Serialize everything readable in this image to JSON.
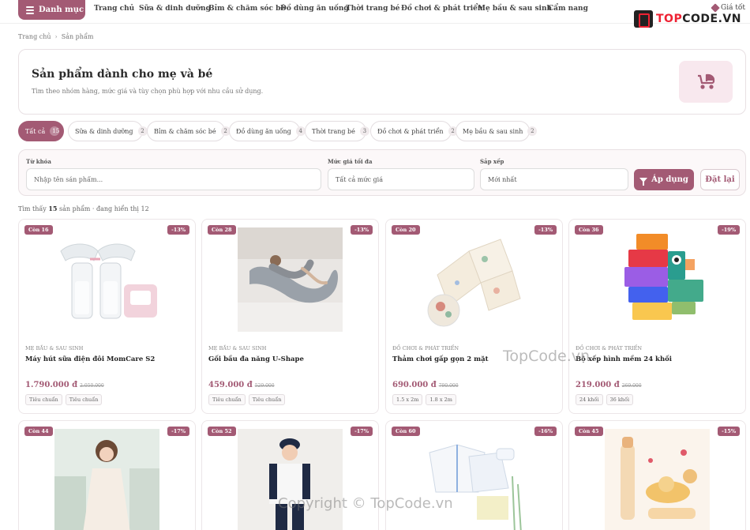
{
  "nav": {
    "menu_label": "Danh mục",
    "links": [
      "Trang chủ",
      "Sữa & dinh dưỡng",
      "Bỉm & chăm sóc bé",
      "Đồ dùng ăn uống",
      "Thời trang bé",
      "Đồ chơi & phát triển",
      "Mẹ bầu & sau sinh",
      "Cẩm nang"
    ],
    "cart_label": "Giá tốt",
    "logo_a": "TOP",
    "logo_b": "CODE.VN"
  },
  "breadcrumb": [
    "Trang chủ",
    "Sản phẩm"
  ],
  "hero": {
    "title": "Sản phẩm dành cho mẹ và bé",
    "subtitle": "Tìm theo nhóm hàng, mức giá và tùy chọn phù hợp với nhu cầu sử dụng."
  },
  "categories": [
    {
      "label": "Tất cả",
      "count": "15"
    },
    {
      "label": "Sữa & dinh dưỡng",
      "count": "2"
    },
    {
      "label": "Bỉm & chăm sóc bé",
      "count": "2"
    },
    {
      "label": "Đồ dùng ăn uống",
      "count": "4"
    },
    {
      "label": "Thời trang bé",
      "count": "3"
    },
    {
      "label": "Đồ chơi & phát triển",
      "count": "2"
    },
    {
      "label": "Mẹ bầu & sau sinh",
      "count": "2"
    }
  ],
  "filter": {
    "keyword_label": "Từ khóa",
    "keyword_placeholder": "Nhập tên sản phẩm...",
    "price_label": "Mức giá tối đa",
    "price_value": "Tất cả mức giá",
    "sort_label": "Sắp xếp",
    "sort_value": "Mới nhất",
    "apply_label": "Áp dụng",
    "reset_label": "Đặt lại"
  },
  "result": {
    "prefix": "Tìm thấy",
    "count": "15",
    "suffix": "sản phẩm · đang hiển thị 12"
  },
  "products": [
    {
      "stock": "Còn 16",
      "discount": "-13%",
      "category": "Mẹ bầu & sau sinh",
      "name": "Máy hút sữa điện đôi MomCare S2",
      "price": "1.790.000 đ",
      "old_price": "2.050.000",
      "tags": [
        "Tiêu chuẩn",
        "Tiêu chuẩn"
      ]
    },
    {
      "stock": "Còn 28",
      "discount": "-13%",
      "category": "Mẹ bầu & sau sinh",
      "name": "Gối bầu đa năng U-Shape",
      "price": "459.000 đ",
      "old_price": "529.000",
      "tags": [
        "Tiêu chuẩn",
        "Tiêu chuẩn"
      ]
    },
    {
      "stock": "Còn 20",
      "discount": "-13%",
      "category": "Đồ chơi & phát triển",
      "name": "Thảm chơi gấp gọn 2 mặt",
      "price": "690.000 đ",
      "old_price": "790.000",
      "tags": [
        "1.5 x 2m",
        "1.8 x 2m"
      ]
    },
    {
      "stock": "Còn 36",
      "discount": "-19%",
      "category": "Đồ chơi & phát triển",
      "name": "Bộ xếp hình mềm 24 khối",
      "price": "219.000 đ",
      "old_price": "269.000",
      "tags": [
        "24 khối",
        "36 khối"
      ]
    },
    {
      "stock": "Còn 44",
      "discount": "-17%"
    },
    {
      "stock": "Còn 52",
      "discount": "-17%"
    },
    {
      "stock": "Còn 60",
      "discount": "-16%"
    },
    {
      "stock": "Còn 45",
      "discount": "-15%"
    }
  ],
  "watermarks": [
    "TopCode.vn",
    "Copyright © TopCode.vn"
  ],
  "colors": {
    "accent": "#a35a74",
    "accent_light": "#f8e8ee"
  }
}
